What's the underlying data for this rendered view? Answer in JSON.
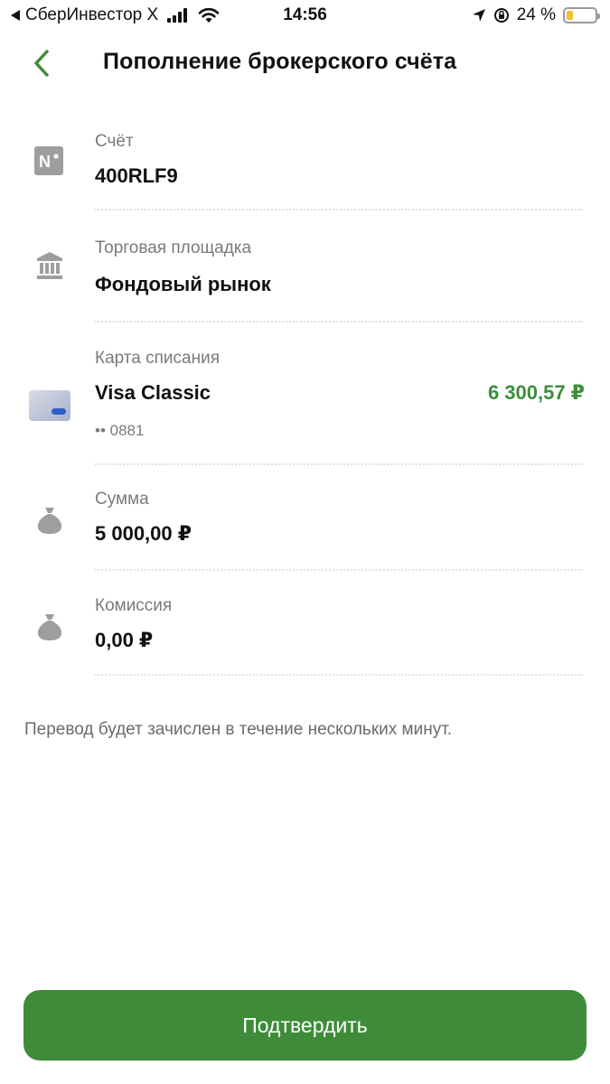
{
  "status_bar": {
    "back_app": "СберИнвестор X",
    "time": "14:56",
    "battery": "24 %",
    "battery_level": 0.24
  },
  "header": {
    "title": "Пополнение брокерского счёта",
    "back_icon": "chevron-left-icon"
  },
  "rows": {
    "account": {
      "label": "Счёт",
      "value": "400RLF9",
      "icon_text": "N°"
    },
    "market": {
      "label": "Торговая площадка",
      "value": "Фондовый рынок"
    },
    "card": {
      "label": "Карта списания",
      "value": "Visa Classic",
      "masked": "•• 0881",
      "balance": "6 300,57 ₽"
    },
    "amount": {
      "label": "Сумма",
      "value": "5 000,00 ₽"
    },
    "commission": {
      "label": "Комиссия",
      "value": "0,00 ₽"
    }
  },
  "note": "Перевод будет зачислен в течение нескольких минут.",
  "confirm_button": "Подтвердить",
  "colors": {
    "accent": "#3e8c3a",
    "amount_green": "#3d8f3a",
    "icon_gray": "#9e9e9e"
  }
}
